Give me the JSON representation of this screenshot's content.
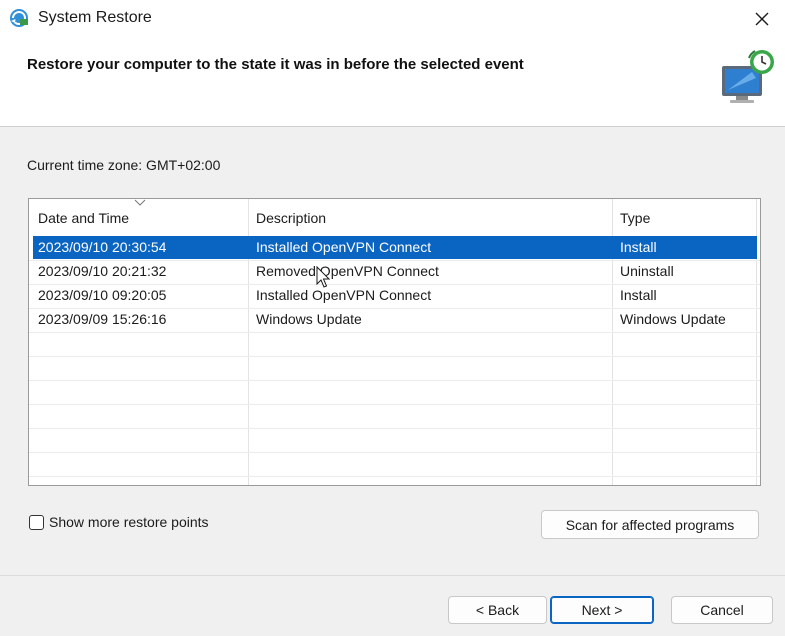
{
  "window": {
    "title": "System Restore",
    "app_icon": "system-restore-icon",
    "close_icon": "close-icon"
  },
  "header": {
    "title": "Restore your computer to the state it was in before the selected event",
    "graphic": "monitor-restore-icon"
  },
  "timezone": {
    "label": "Current time zone: GMT+02:00"
  },
  "table": {
    "columns": [
      "Date and Time",
      "Description",
      "Type"
    ],
    "rows": [
      {
        "date": "2023/09/10 20:30:54",
        "description": "Installed OpenVPN Connect",
        "type": "Install",
        "selected": true
      },
      {
        "date": "2023/09/10 20:21:32",
        "description": "Removed OpenVPN Connect",
        "type": "Uninstall",
        "selected": false
      },
      {
        "date": "2023/09/10 09:20:05",
        "description": "Installed OpenVPN Connect",
        "type": "Install",
        "selected": false
      },
      {
        "date": "2023/09/09 15:26:16",
        "description": "Windows Update",
        "type": "Windows Update",
        "selected": false
      }
    ]
  },
  "options": {
    "show_more_label": "Show more restore points",
    "show_more_checked": false
  },
  "buttons": {
    "scan": "Scan for affected programs",
    "back": "< Back",
    "next": "Next >",
    "cancel": "Cancel"
  },
  "colors": {
    "selection": "#0a64c2",
    "window_bg": "#f0f0f0"
  }
}
